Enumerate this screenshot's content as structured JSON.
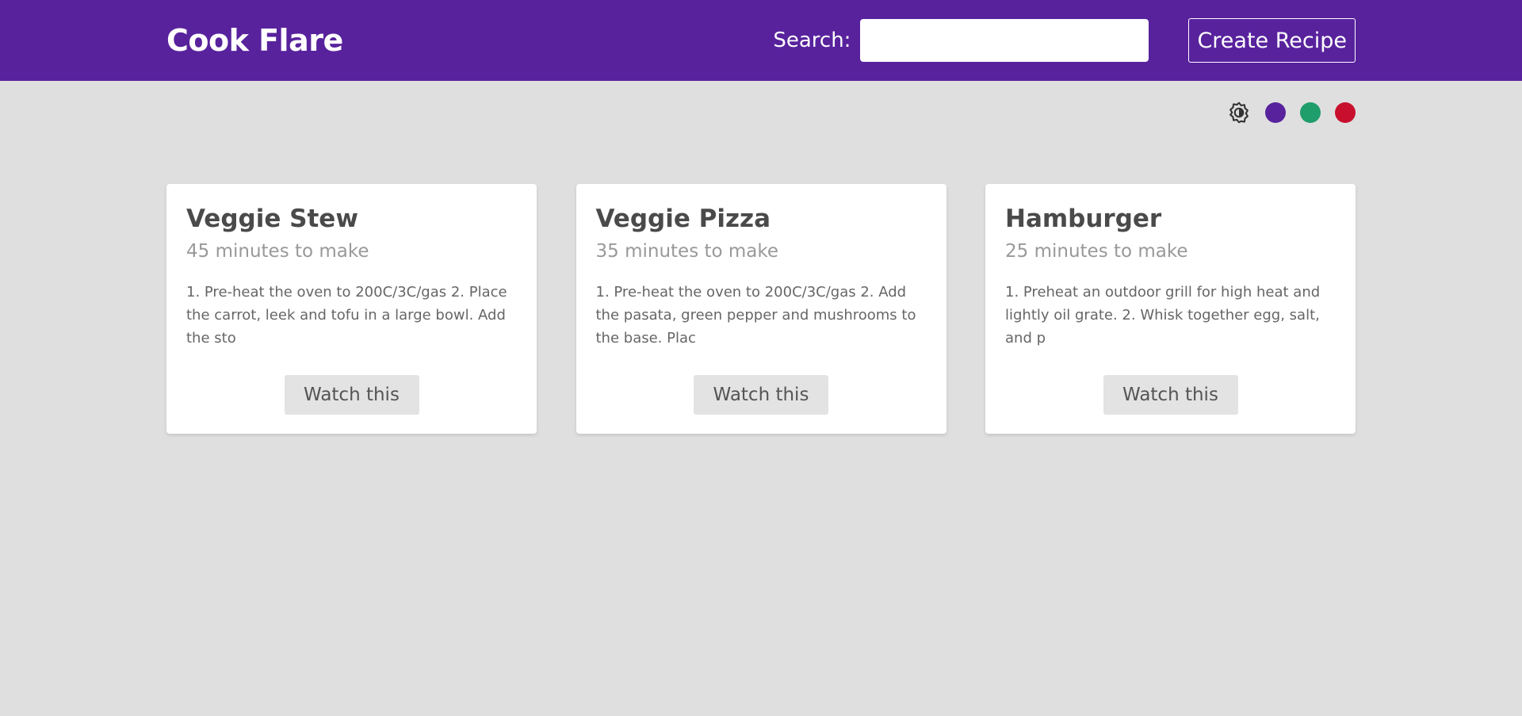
{
  "header": {
    "brand": "Cook Flare",
    "search_label": "Search:",
    "search_value": "",
    "search_placeholder": "",
    "create_label": "Create Recipe"
  },
  "theme": {
    "icon": "brightness-icon",
    "colors": [
      "#58229d",
      "#1f9d6b",
      "#c8102e"
    ]
  },
  "recipes": [
    {
      "title": "Veggie Stew",
      "time": "45 minutes to make",
      "description": "1. Pre-heat the oven to 200C/3C/gas 2. Place the carrot, leek and tofu in a large bowl. Add the sto",
      "button": "Watch this"
    },
    {
      "title": "Veggie Pizza",
      "time": "35 minutes to make",
      "description": "1. Pre-heat the oven to 200C/3C/gas 2. Add the pasata, green pepper and mushrooms to the base. Plac",
      "button": "Watch this"
    },
    {
      "title": "Hamburger",
      "time": "25 minutes to make",
      "description": "1. Preheat an outdoor grill for high heat and lightly oil grate. 2. Whisk together egg, salt, and p",
      "button": "Watch this"
    }
  ]
}
